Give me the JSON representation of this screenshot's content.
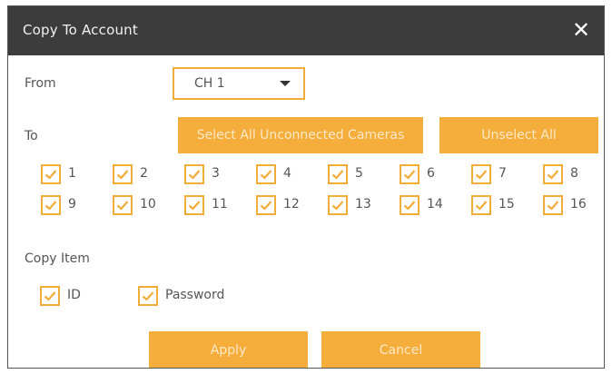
{
  "dialog": {
    "title": "Copy To Account",
    "close_label": "✕"
  },
  "from": {
    "label": "From",
    "selected": "CH 1"
  },
  "to": {
    "label": "To",
    "select_all_label": "Select All Unconnected Cameras",
    "unselect_all_label": "Unselect All",
    "channels": [
      {
        "label": "1",
        "checked": true
      },
      {
        "label": "2",
        "checked": true
      },
      {
        "label": "3",
        "checked": true
      },
      {
        "label": "4",
        "checked": true
      },
      {
        "label": "5",
        "checked": true
      },
      {
        "label": "6",
        "checked": true
      },
      {
        "label": "7",
        "checked": true
      },
      {
        "label": "8",
        "checked": true
      },
      {
        "label": "9",
        "checked": true
      },
      {
        "label": "10",
        "checked": true
      },
      {
        "label": "11",
        "checked": true
      },
      {
        "label": "12",
        "checked": true
      },
      {
        "label": "13",
        "checked": true
      },
      {
        "label": "14",
        "checked": true
      },
      {
        "label": "15",
        "checked": true
      },
      {
        "label": "16",
        "checked": true
      }
    ]
  },
  "copy_item": {
    "label": "Copy Item",
    "items": [
      {
        "label": "ID",
        "checked": true
      },
      {
        "label": "Password",
        "checked": true
      }
    ]
  },
  "footer": {
    "apply_label": "Apply",
    "cancel_label": "Cancel"
  },
  "colors": {
    "accent": "#f5ad3b",
    "titlebar": "#3c3c3c"
  }
}
